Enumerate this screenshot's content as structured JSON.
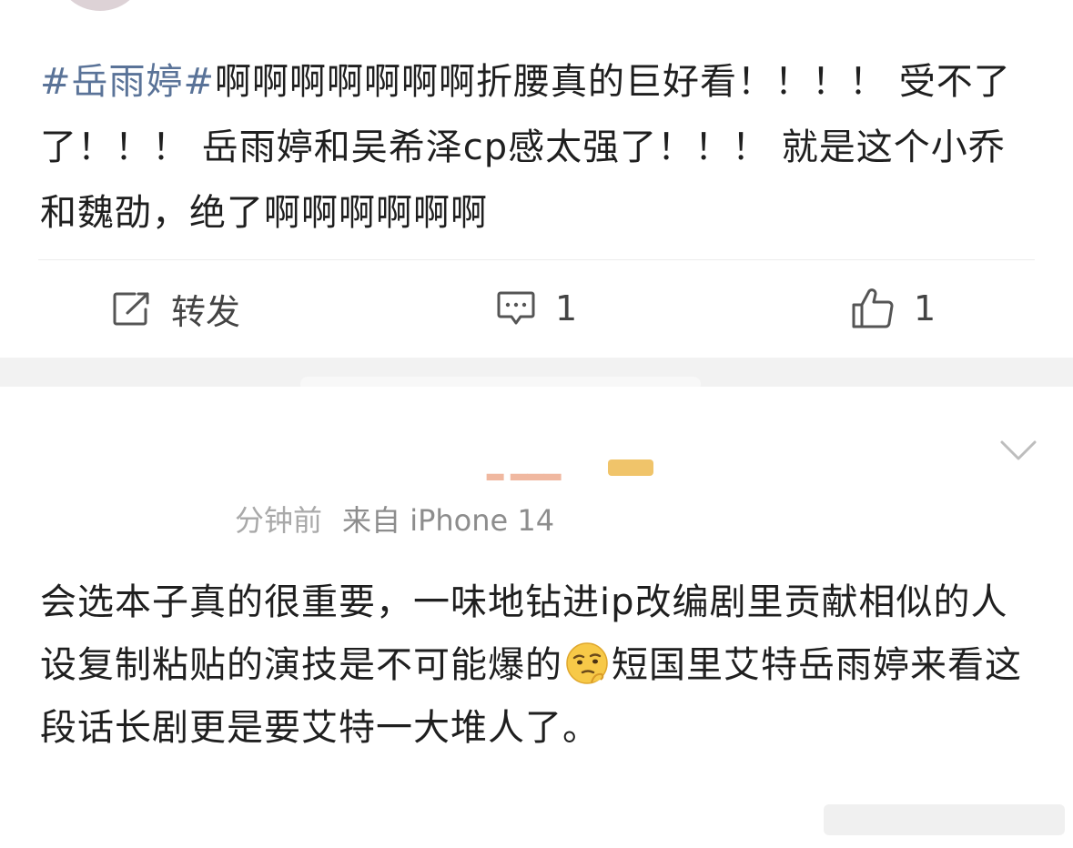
{
  "post": {
    "hashtag": "#岳雨婷#",
    "text": "啊啊啊啊啊啊啊折腰真的巨好看！！！！ 受不了了！！！ 岳雨婷和吴希泽cp感太强了！！！ 就是这个小乔和魏劭，绝了啊啊啊啊啊啊"
  },
  "actions": {
    "repost_label": "转发",
    "comment_count": "1",
    "like_count": "1"
  },
  "comment": {
    "time": "分钟前",
    "source": "来自 iPhone 14",
    "text_1": "会选本子真的很重要，一味地钻进ip改编剧里贡献相似的人设复制粘贴的演技是不可能爆的",
    "text_2": "短国里艾特岳雨婷来看这段话长剧更是要艾特一大堆人了。",
    "emoji": "thinking-face-emoji"
  },
  "icons": {
    "repost": "repost-icon",
    "comment": "comment-icon",
    "like": "thumbs-up-icon",
    "more": "chevron-down-icon"
  },
  "colors": {
    "hashtag": "#5a7398",
    "text": "#1f1f1f",
    "meta": "#8d8d8d",
    "icon": "#555555"
  }
}
